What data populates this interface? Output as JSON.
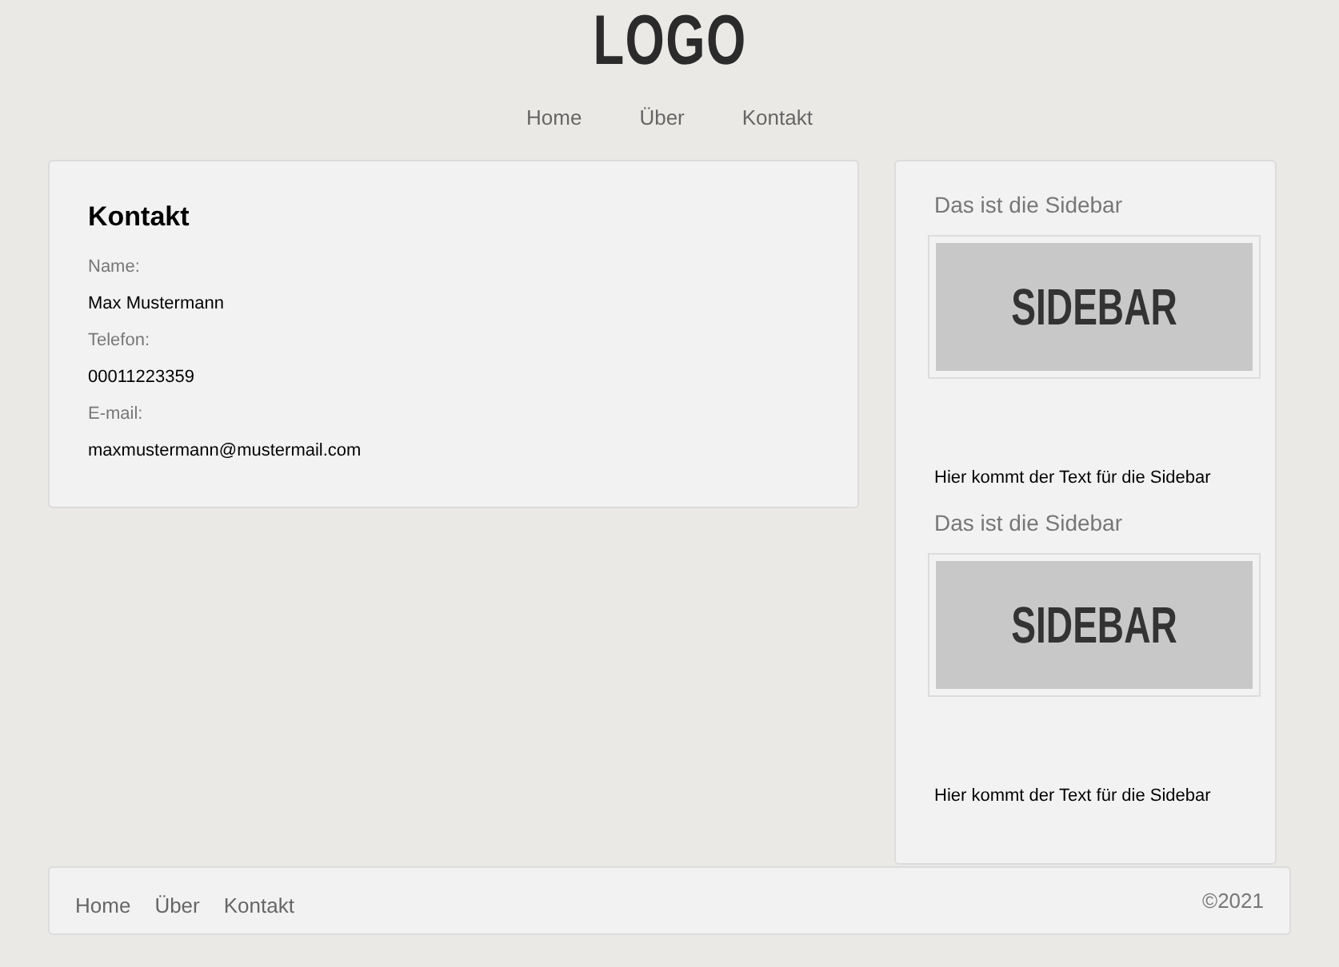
{
  "header": {
    "logo": "LOGO",
    "nav": [
      "Home",
      "Über",
      "Kontakt"
    ]
  },
  "contact": {
    "title": "Kontakt",
    "fields": [
      {
        "label": "Name:",
        "value": "Max Mustermann"
      },
      {
        "label": "Telefon:",
        "value": "00011223359"
      },
      {
        "label": "E-mail:",
        "value": "maxmustermann@mustermail.com"
      }
    ]
  },
  "sidebar": {
    "widgets": [
      {
        "title": "Das ist die Sidebar",
        "image_text": "SIDEBAR",
        "text": "Hier kommt der Text für die Sidebar"
      },
      {
        "title": "Das ist die Sidebar",
        "image_text": "SIDEBAR",
        "text": "Hier kommt der Text für die Sidebar"
      }
    ]
  },
  "footer": {
    "nav": [
      "Home",
      "Über",
      "Kontakt"
    ],
    "copyright": "©2021"
  }
}
